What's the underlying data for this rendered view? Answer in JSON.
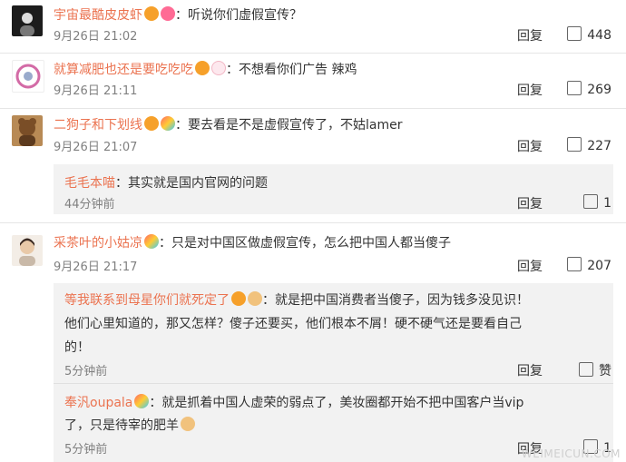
{
  "comments": [
    {
      "user": "宇宙最酷皮皮虾",
      "text": "：听说你们虚假宣传？",
      "time": "9月26日 21:02",
      "reply": "回复",
      "likes": "448"
    },
    {
      "user": "就算减肥也还是要吃吃吃",
      "text": "：不想看你们广告 辣鸡",
      "time": "9月26日 21:11",
      "reply": "回复",
      "likes": "269"
    },
    {
      "user": "二狗子和下划线",
      "text": "：要去看是不是虚假宣传了，不姑lamer",
      "time": "9月26日 21:07",
      "reply": "回复",
      "likes": "227"
    },
    {
      "user": "采茶叶的小姑凉",
      "text": "：只是对中国区做虚假宣传，怎么把中国人都当傻子",
      "time": "9月26日 21:17",
      "reply": "回复",
      "likes": "207"
    }
  ],
  "replies": [
    {
      "user": "毛毛本喵",
      "text": "：其实就是国内官网的问题",
      "time": "44分钟前",
      "reply": "回复",
      "likes": "1"
    },
    {
      "user": "等我联系到母星你们就死定了",
      "text_line1": "：就是把中国消费者当傻子，因为钱多没见识！",
      "text_line2": "他们心里知道的，那又怎样？傻子还要买，他们根本不屑！硬不硬气还是要看自己",
      "text_line3": "的！",
      "time": "5分钟前",
      "reply": "回复",
      "likes": "赞"
    },
    {
      "user": "奉汎oupala",
      "text_line1": "：就是抓着中国人虚荣的弱点了，美妆圈都开始不把中国客户当vip",
      "text_line2": "了，只是待宰的肥羊",
      "time": "5分钟前",
      "reply": "回复",
      "likes": "1"
    }
  ],
  "watermark": "WEIMEICUN.COM",
  "colors": {
    "username": "#eb7350",
    "text": "#333333",
    "time": "#808080",
    "reply_bg": "#f2f2f2"
  }
}
